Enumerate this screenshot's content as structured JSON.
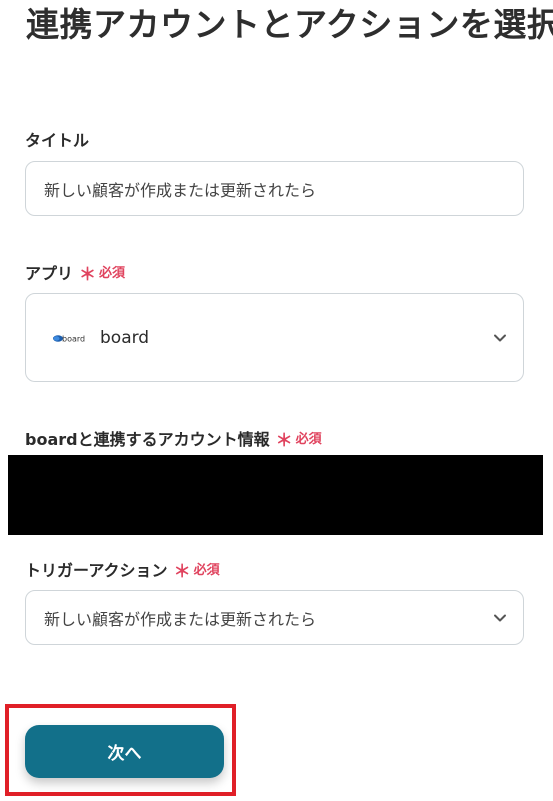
{
  "page": {
    "title": "連携アカウントとアクションを選択"
  },
  "title_field": {
    "label": "タイトル",
    "value": "新しい顧客が作成または更新されたら"
  },
  "app_field": {
    "label": "アプリ",
    "required_label": "必須",
    "required_mark": "＊",
    "app_name": "board",
    "logo_text": "board",
    "icon": "chevron-down-icon"
  },
  "account_field": {
    "label": "boardと連携するアカウント情報",
    "required_label": "必須",
    "required_mark": "＊"
  },
  "trigger_field": {
    "label": "トリガーアクション",
    "required_label": "必須",
    "required_mark": "＊",
    "value": "新しい顧客が作成または更新されたら",
    "icon": "chevron-down-icon"
  },
  "actions": {
    "next_label": "次へ"
  },
  "colors": {
    "primary_button": "#12708a",
    "required": "#e0435e",
    "highlight": "#e01f27",
    "border": "#cfd5d9"
  }
}
